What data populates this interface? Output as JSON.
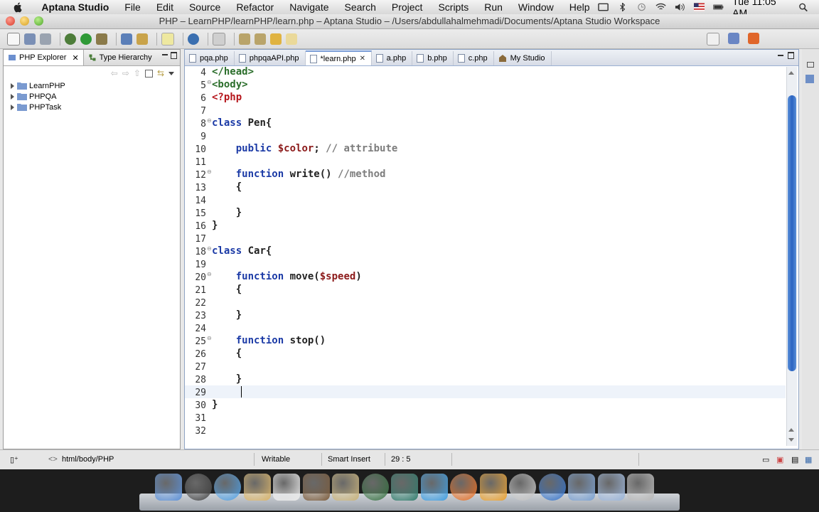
{
  "menubar": {
    "app_name": "Aptana Studio",
    "menus": [
      "File",
      "Edit",
      "Source",
      "Refactor",
      "Navigate",
      "Search",
      "Project",
      "Scripts",
      "Run",
      "Window",
      "Help"
    ],
    "clock": "Tue 11:05 AM"
  },
  "window": {
    "title": "PHP – LearnPHP/learnPHP/learn.php – Aptana Studio – /Users/abdullahalmehmadi/Documents/Aptana Studio Workspace"
  },
  "left_panel": {
    "tabs": [
      {
        "label": "PHP Explorer",
        "active": true
      },
      {
        "label": "Type Hierarchy",
        "active": false
      }
    ],
    "projects": [
      "LearnPHP",
      "PHPQA",
      "PHPTask"
    ]
  },
  "editor": {
    "tabs": [
      {
        "label": "pqa.php",
        "active": false
      },
      {
        "label": "phpqaAPI.php",
        "active": false
      },
      {
        "label": "*learn.php",
        "active": true
      },
      {
        "label": "a.php",
        "active": false
      },
      {
        "label": "b.php",
        "active": false
      },
      {
        "label": "c.php",
        "active": false
      },
      {
        "label": "My Studio",
        "active": false
      }
    ],
    "lines": [
      {
        "n": "4",
        "fold": false,
        "segs": [
          {
            "t": "</head>",
            "c": "tag"
          }
        ]
      },
      {
        "n": "5",
        "fold": true,
        "segs": [
          {
            "t": "<body>",
            "c": "tag"
          }
        ]
      },
      {
        "n": "6",
        "fold": false,
        "segs": [
          {
            "t": "<?php",
            "c": "php"
          }
        ]
      },
      {
        "n": "7",
        "fold": false,
        "segs": []
      },
      {
        "n": "8",
        "fold": true,
        "segs": [
          {
            "t": "class",
            "c": "kw"
          },
          {
            "t": " Pen{",
            "c": "plain"
          }
        ]
      },
      {
        "n": "9",
        "fold": false,
        "segs": []
      },
      {
        "n": "10",
        "fold": false,
        "segs": [
          {
            "t": "    ",
            "c": "plain"
          },
          {
            "t": "public",
            "c": "kw"
          },
          {
            "t": " ",
            "c": "plain"
          },
          {
            "t": "$color",
            "c": "var"
          },
          {
            "t": "; ",
            "c": "plain"
          },
          {
            "t": "// attribute",
            "c": "cmt"
          }
        ]
      },
      {
        "n": "11",
        "fold": false,
        "segs": []
      },
      {
        "n": "12",
        "fold": true,
        "segs": [
          {
            "t": "    ",
            "c": "plain"
          },
          {
            "t": "function",
            "c": "kw"
          },
          {
            "t": " write() ",
            "c": "plain"
          },
          {
            "t": "//method",
            "c": "cmt"
          }
        ]
      },
      {
        "n": "13",
        "fold": false,
        "segs": [
          {
            "t": "    {",
            "c": "plain"
          }
        ]
      },
      {
        "n": "14",
        "fold": false,
        "segs": []
      },
      {
        "n": "15",
        "fold": false,
        "segs": [
          {
            "t": "    }",
            "c": "plain"
          }
        ]
      },
      {
        "n": "16",
        "fold": false,
        "segs": [
          {
            "t": "}",
            "c": "plain"
          }
        ]
      },
      {
        "n": "17",
        "fold": false,
        "segs": []
      },
      {
        "n": "18",
        "fold": true,
        "segs": [
          {
            "t": "class",
            "c": "kw"
          },
          {
            "t": " Car{",
            "c": "plain"
          }
        ]
      },
      {
        "n": "19",
        "fold": false,
        "segs": []
      },
      {
        "n": "20",
        "fold": true,
        "segs": [
          {
            "t": "    ",
            "c": "plain"
          },
          {
            "t": "function",
            "c": "kw"
          },
          {
            "t": " move(",
            "c": "plain"
          },
          {
            "t": "$speed",
            "c": "var"
          },
          {
            "t": ")",
            "c": "plain"
          }
        ]
      },
      {
        "n": "21",
        "fold": false,
        "segs": [
          {
            "t": "    {",
            "c": "plain"
          }
        ]
      },
      {
        "n": "22",
        "fold": false,
        "segs": []
      },
      {
        "n": "23",
        "fold": false,
        "segs": [
          {
            "t": "    }",
            "c": "plain"
          }
        ]
      },
      {
        "n": "24",
        "fold": false,
        "segs": []
      },
      {
        "n": "25",
        "fold": true,
        "segs": [
          {
            "t": "    ",
            "c": "plain"
          },
          {
            "t": "function",
            "c": "kw"
          },
          {
            "t": " stop()",
            "c": "plain"
          }
        ]
      },
      {
        "n": "26",
        "fold": false,
        "segs": [
          {
            "t": "    {",
            "c": "plain"
          }
        ]
      },
      {
        "n": "27",
        "fold": false,
        "segs": []
      },
      {
        "n": "28",
        "fold": false,
        "segs": [
          {
            "t": "    }",
            "c": "plain"
          }
        ]
      },
      {
        "n": "29",
        "fold": false,
        "segs": []
      },
      {
        "n": "30",
        "fold": false,
        "segs": [
          {
            "t": "}",
            "c": "plain"
          }
        ]
      },
      {
        "n": "31",
        "fold": false,
        "segs": []
      },
      {
        "n": "32",
        "fold": false,
        "segs": []
      }
    ],
    "current_line": "29"
  },
  "statusbar": {
    "breadcrumb": "html/body/PHP",
    "mode": "Writable",
    "insert_mode": "Smart Insert",
    "position": "29 : 5"
  },
  "dock": {
    "icons": [
      "finder-icon",
      "dashboard-icon",
      "safari-icon",
      "mail-icon",
      "ical-icon",
      "iphoto-icon",
      "imovie-icon",
      "time-machine-icon",
      "zoin-icon",
      "ichat-icon",
      "firefox-icon",
      "preferences-icon",
      "skype-icon",
      "quicktime-icon",
      "applications-folder-icon",
      "documents-folder-icon",
      "trash-icon"
    ]
  },
  "colors": {
    "keyword": "#1b3aa6",
    "html_tag": "#2b6e2b",
    "php_tag": "#b5151b",
    "variable": "#8c1a1a",
    "comment": "#7d7d7d",
    "scroll_thumb": "#2a63c1"
  }
}
